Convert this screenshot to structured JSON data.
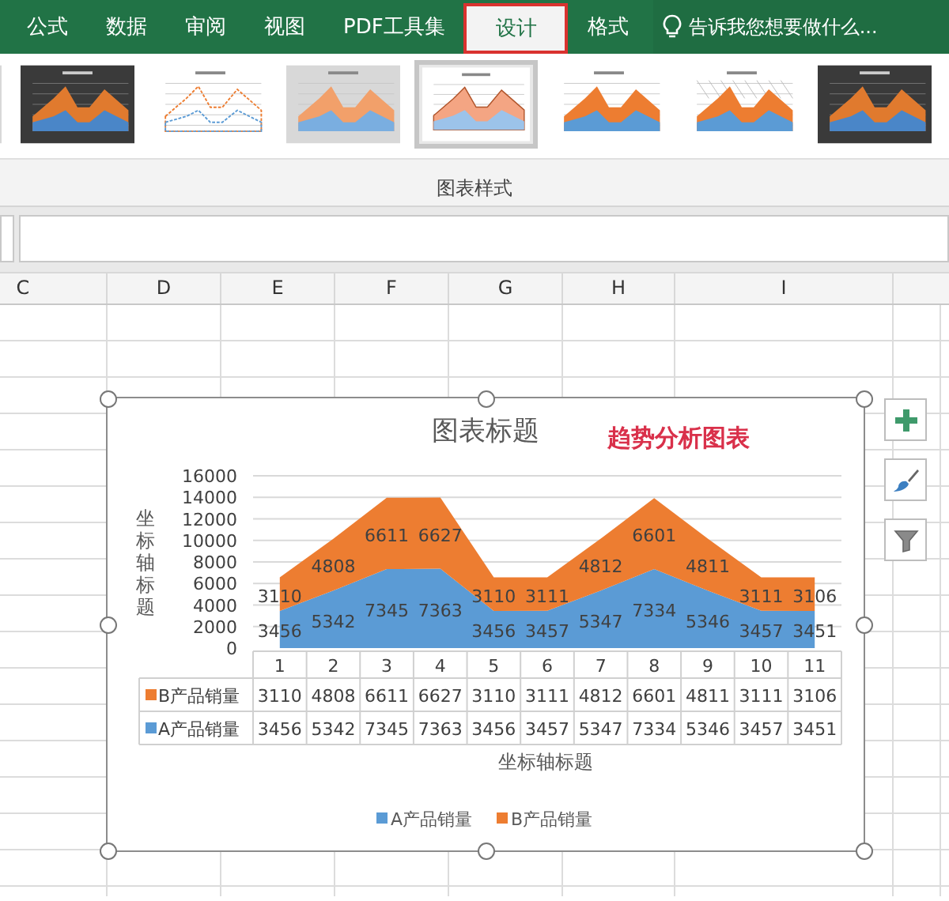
{
  "ribbon": {
    "tabs": [
      {
        "label": "公式",
        "selected": false
      },
      {
        "label": "数据",
        "selected": false
      },
      {
        "label": "审阅",
        "selected": false
      },
      {
        "label": "视图",
        "selected": false
      },
      {
        "label": "PDF工具集",
        "selected": false
      },
      {
        "label": "设计",
        "selected": true
      },
      {
        "label": "格式",
        "selected": false
      }
    ],
    "tell_me": {
      "placeholder": "告诉我您想要做什么..."
    }
  },
  "chart_styles": {
    "items": [
      {
        "kind": "gray",
        "selected": false
      },
      {
        "kind": "dark",
        "selected": false
      },
      {
        "kind": "hatched",
        "selected": false
      },
      {
        "kind": "gray",
        "selected": false
      },
      {
        "kind": "outline",
        "selected": true
      },
      {
        "kind": "plain",
        "selected": false
      },
      {
        "kind": "pattern",
        "selected": false
      },
      {
        "kind": "dark",
        "selected": false
      }
    ],
    "group_label": "图表样式"
  },
  "columns": [
    "C",
    "D",
    "E",
    "F",
    "G",
    "H",
    "I"
  ],
  "chart": {
    "annotation": "趋势分析图表",
    "chart_data": {
      "type": "area",
      "stacked": true,
      "grid": true,
      "legend": "bottom",
      "title": "图表标题",
      "xlabel": "坐标轴标题",
      "ylabel": "坐标轴标题",
      "categories": [
        "1",
        "2",
        "3",
        "4",
        "5",
        "6",
        "7",
        "8",
        "9",
        "10",
        "11"
      ],
      "ylim": [
        0,
        16000
      ],
      "yticks": [
        0,
        2000,
        4000,
        6000,
        8000,
        10000,
        12000,
        14000,
        16000
      ],
      "value_labels": [
        [
          "3456",
          "5342",
          "7345",
          "7363",
          "3456",
          "3457",
          "5347",
          "7334",
          "5346",
          "3457",
          "3451"
        ],
        [
          "3110",
          "4808",
          "6611",
          "6627",
          "3110",
          "3111",
          "4812",
          "6601",
          "4811",
          "3111",
          "3106"
        ]
      ],
      "series": [
        {
          "name": "A产品销量",
          "color": "#5b9bd5",
          "values": [
            3456,
            5342,
            7345,
            7363,
            3456,
            3457,
            5347,
            7334,
            5346,
            3457,
            3451
          ]
        },
        {
          "name": "B产品销量",
          "color": "#ed7d31",
          "values": [
            3110,
            4808,
            6611,
            6627,
            3110,
            3111,
            4812,
            6601,
            4811,
            3111,
            3106
          ]
        }
      ]
    },
    "data_table": {
      "rows": [
        {
          "label": "B产品销量",
          "color": "#ed7d31",
          "cells": [
            "3110",
            "4808",
            "6611",
            "6627",
            "3110",
            "3111",
            "4812",
            "6601",
            "4811",
            "3111",
            "3106"
          ]
        },
        {
          "label": "A产品销量",
          "color": "#5b9bd5",
          "cells": [
            "3456",
            "5342",
            "7345",
            "7363",
            "3456",
            "3457",
            "5347",
            "7334",
            "5346",
            "3457",
            "3451"
          ]
        }
      ]
    }
  }
}
